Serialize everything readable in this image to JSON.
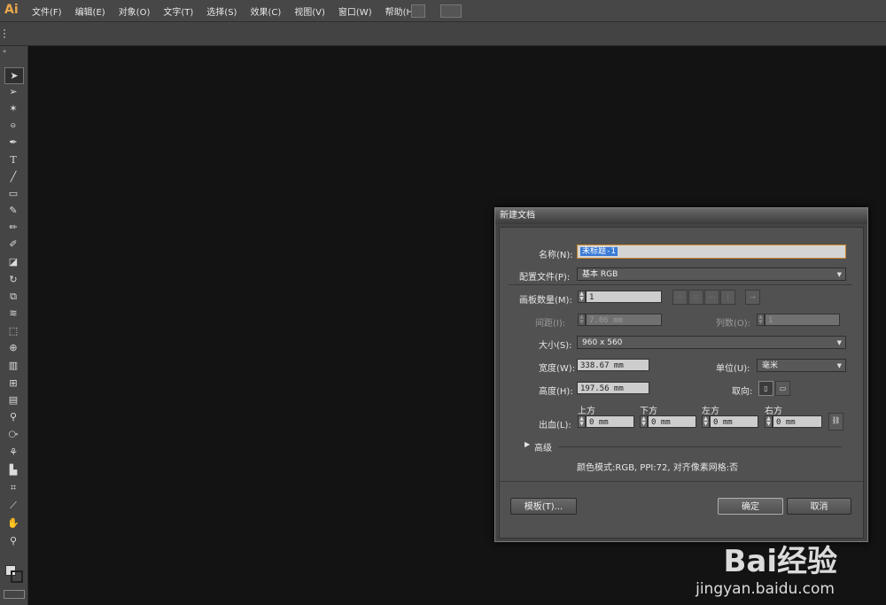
{
  "app": {
    "logo": "Ai"
  },
  "menu": [
    "文件(F)",
    "编辑(E)",
    "对象(O)",
    "文字(T)",
    "选择(S)",
    "效果(C)",
    "视图(V)",
    "窗口(W)",
    "帮助(H)"
  ],
  "tools": [
    "selection-tool",
    "direct-selection-tool",
    "magic-wand-tool",
    "lasso-tool",
    "pen-tool",
    "type-tool",
    "line-tool",
    "rectangle-tool",
    "paintbrush-tool",
    "pencil-tool",
    "blob-brush-tool",
    "eraser-tool",
    "rotate-tool",
    "scale-tool",
    "warp-tool",
    "free-transform-tool",
    "shape-builder-tool",
    "perspective-grid-tool",
    "mesh-tool",
    "gradient-tool",
    "eyedropper-tool",
    "blend-tool",
    "symbol-sprayer-tool",
    "column-graph-tool",
    "artboard-tool",
    "slice-tool",
    "hand-tool",
    "zoom-tool"
  ],
  "dialog": {
    "title": "新建文档",
    "name_label": "名称(N):",
    "name_value": "未标题-1",
    "profile_label": "配置文件(P):",
    "profile_value": "基本 RGB",
    "artboards_label": "画板数量(M):",
    "artboards_value": "1",
    "spacing_label": "间距(I):",
    "spacing_value": "7.06 mm",
    "columns_label": "列数(O):",
    "columns_value": "1",
    "size_label": "大小(S):",
    "size_value": "960 x 560",
    "width_label": "宽度(W):",
    "width_value": "338.67 mm",
    "units_label": "单位(U):",
    "units_value": "毫米",
    "height_label": "高度(H):",
    "height_value": "197.56 mm",
    "orientation_label": "取向:",
    "bleed_label": "出血(L):",
    "bleed_top_label": "上方",
    "bleed_bottom_label": "下方",
    "bleed_left_label": "左方",
    "bleed_right_label": "右方",
    "bleed_top": "0 mm",
    "bleed_bottom": "0 mm",
    "bleed_left": "0 mm",
    "bleed_right": "0 mm",
    "advanced_label": "高级",
    "info": "颜色模式:RGB, PPI:72, 对齐像素网格:否",
    "templates_button": "模板(T)...",
    "ok_button": "确定",
    "cancel_button": "取消"
  },
  "watermark": {
    "brand": "Bai经验",
    "url": "jingyan.baidu.com"
  }
}
